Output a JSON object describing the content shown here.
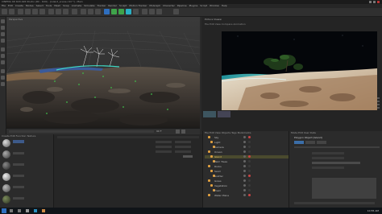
{
  "app": {
    "title": "CINEMA 4D R20.026 Studio (RC - R20) - [island_scene.c4d *] - Main",
    "menus": [
      "File",
      "Edit",
      "Create",
      "Modes",
      "Select",
      "Tools",
      "Mesh",
      "Snap",
      "Animate",
      "Simulate",
      "Tracker",
      "Render",
      "Sculpt",
      "Motion Tracker",
      "MoGraph",
      "Character",
      "Pipeline",
      "Plugins",
      "Script",
      "Window",
      "Help"
    ]
  },
  "viewport": {
    "header": "View  Cameras  Display  Options  Filter  Panel  ProRender",
    "label": "Perspective"
  },
  "timeline": {
    "frame_start": "0",
    "frame_end": "90 F",
    "current": "0 F"
  },
  "render_view": {
    "header": "Picture Viewer",
    "menu": "File  Edit  View  Compare  Animation"
  },
  "materials": {
    "header": "Create  Edit  Function  Texture",
    "items": [
      "Mat",
      "Rock",
      "Sand",
      "Water",
      "Leaf",
      "Bark",
      "Sky",
      "Grass",
      "Sea"
    ]
  },
  "objects": {
    "header": "File  Edit  View  Objects  Tags  Bookmarks",
    "rows": [
      "Sky",
      "Light",
      "Camera",
      "Ocean",
      "Island",
      "Palm Trees",
      "Rocks",
      "Sand",
      "Scatter",
      "Grass",
      "Vegetation",
      "Foam",
      "Water Plane"
    ]
  },
  "attributes": {
    "header": "Mode  Edit  User Data",
    "tabs": [
      "Basic",
      "Coord.",
      "Object"
    ],
    "title": "Polygon Object [Island]"
  },
  "taskbar": {
    "time": "10:55 AM"
  },
  "colors": {
    "accent": "#2f6fbf",
    "selection": "#c8a032",
    "ui_bg": "#2a2a2a"
  }
}
